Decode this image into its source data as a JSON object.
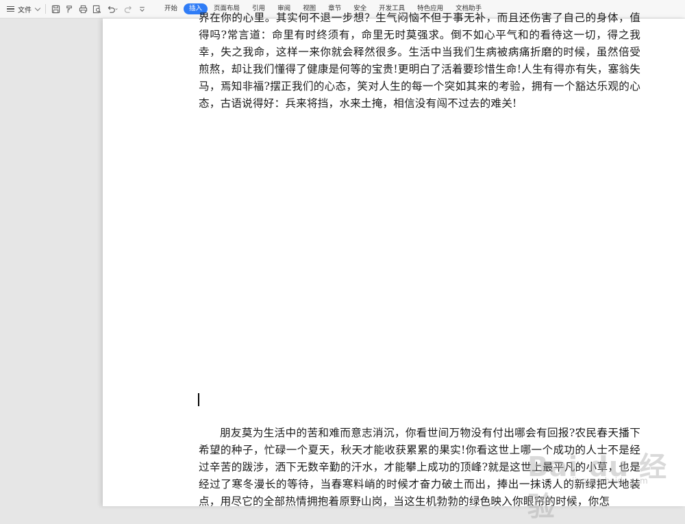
{
  "menu": {
    "file_label": "文件"
  },
  "quick_access": [
    {
      "icon": "save-icon"
    },
    {
      "icon": "format-painter-icon"
    },
    {
      "icon": "print-icon"
    },
    {
      "icon": "print-preview-icon"
    },
    {
      "icon": "undo-icon"
    },
    {
      "icon": "redo-icon"
    },
    {
      "icon": "customize-chevron-icon"
    }
  ],
  "tabs": [
    {
      "label": "开始",
      "active": false
    },
    {
      "label": "插入",
      "active": true
    },
    {
      "label": "页面布局",
      "active": false
    },
    {
      "label": "引用",
      "active": false
    },
    {
      "label": "审阅",
      "active": false
    },
    {
      "label": "视图",
      "active": false
    },
    {
      "label": "章节",
      "active": false
    },
    {
      "label": "安全",
      "active": false
    },
    {
      "label": "开发工具",
      "active": false
    },
    {
      "label": "特色应用",
      "active": false
    },
    {
      "label": "文档助手",
      "active": false
    }
  ],
  "document": {
    "paragraph_top": "界在你的心里。其实何不退一步想？生气闷恼不但于事无补，而且还伤害了自己的身体，值得吗?常言道：命里有时终须有，命里无时莫强求。倒不如心平气和的看待这一切，得之我幸，失之我命，这样一来你就会释然很多。生活中当我们生病被病痛折磨的时候，虽然倍受煎熬，却让我们懂得了健康是何等的宝贵!更明白了活着要珍惜生命!人生有得亦有失，塞翁失马，焉知非福?摆正我们的心态，笑对人生的每一个突如其来的考验，拥有一个豁达乐观的心态，古语说得好：兵来将挡，水来土掩，相信没有闯不过去的难关!",
    "paragraph_bottom": "朋友莫为生活中的苦和难而意志消沉，你看世间万物没有付出哪会有回报?农民春天播下希望的种子，忙碌一个夏天，秋天才能收获累累的果实!你看这世上哪一个成功的人士不是经过辛苦的跋涉，洒下无数辛勤的汗水，才能攀上成功的顶峰?就是这世上最平凡的小草，也是经过了寒冬漫长的等待，当春寒料峭的时候才奋力破土而出，捧出一抹诱人的新绿把大地装点，用尽它的全部热情拥抱着原野山岗，当这生机勃勃的绿色映入你眼帘的时候，你怎"
  },
  "watermark": {
    "text": "Bai du 经验",
    "sub": "jingyan.baidu.com"
  },
  "colors": {
    "accent": "#2f7cf6",
    "toolbar_bg": "#f7f7f7",
    "canvas_bg": "#e6e6e6"
  }
}
